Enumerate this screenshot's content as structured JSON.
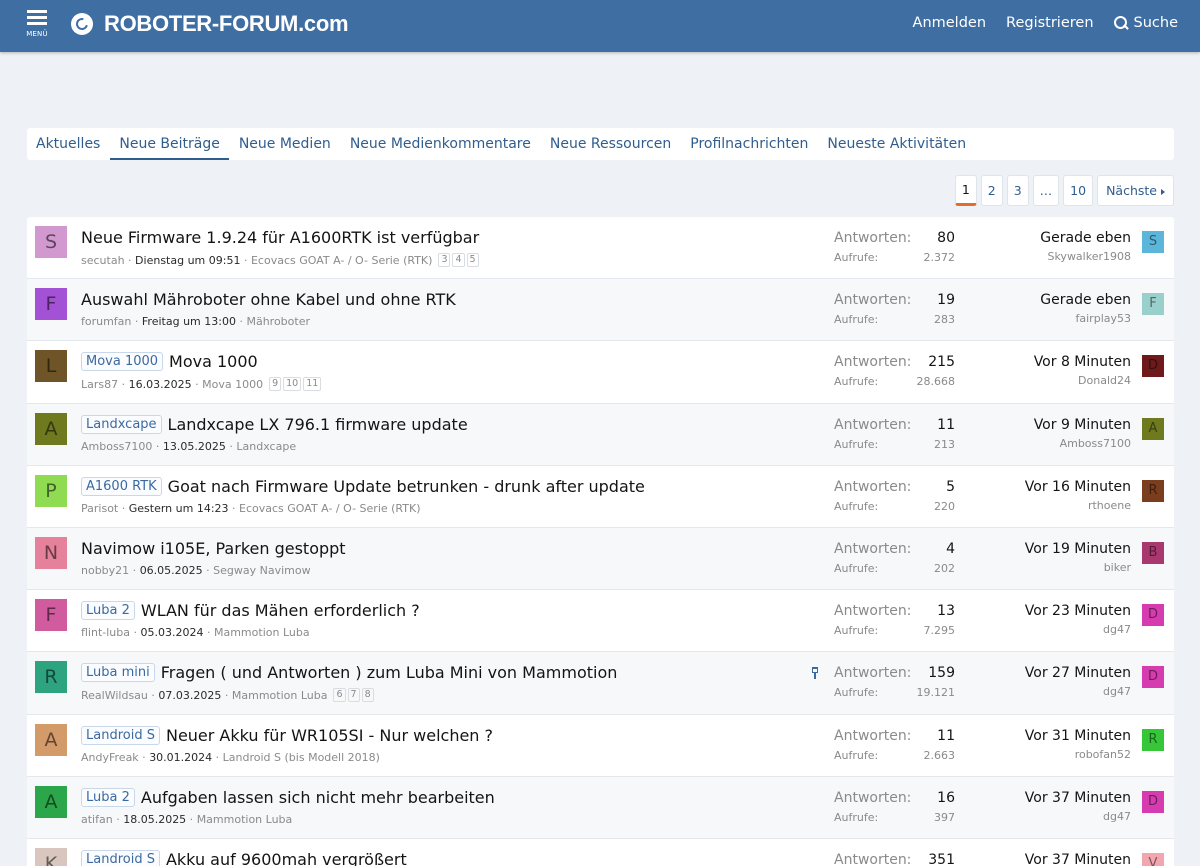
{
  "header": {
    "menu_label": "MENÜ",
    "logo_text": "ROBOTER-FORUM.com",
    "login": "Anmelden",
    "register": "Registrieren",
    "search": "Suche"
  },
  "tabs": [
    "Aktuelles",
    "Neue Beiträge",
    "Neue Medien",
    "Neue Medienkommentare",
    "Neue Ressourcen",
    "Profilnachrichten",
    "Neueste Aktivitäten"
  ],
  "active_tab": "Neue Beiträge",
  "pagination": {
    "pages": [
      "1",
      "2",
      "3",
      "…",
      "10"
    ],
    "current": "1",
    "next": "Nächste"
  },
  "labels": {
    "replies": "Antworten:",
    "views": "Aufrufe:"
  },
  "threads": [
    {
      "letter": "S",
      "color": "#d199cf",
      "prefix": "",
      "title": "Neue Firmware 1.9.24 für A1600RTK ist verfügbar",
      "author": "secutah",
      "date": "Dienstag um 09:51",
      "forum": "Ecovacs GOAT A- / O- Serie (RTK)",
      "pages": [
        "3",
        "4",
        "5"
      ],
      "replies": "80",
      "views": "2.372",
      "last_time": "Gerade eben",
      "last_user": "Skywalker1908",
      "last_letter": "S",
      "last_color": "#5cb6da",
      "pinned": false
    },
    {
      "letter": "F",
      "color": "#a352d6",
      "prefix": "",
      "title": "Auswahl Mähroboter ohne Kabel und ohne RTK",
      "author": "forumfan",
      "date": "Freitag um 13:00",
      "forum": "Mähroboter",
      "pages": [],
      "replies": "19",
      "views": "283",
      "last_time": "Gerade eben",
      "last_user": "fairplay53",
      "last_letter": "F",
      "last_color": "#9ad0cc",
      "pinned": false
    },
    {
      "letter": "L",
      "color": "#6f5427",
      "prefix": "Mova 1000",
      "title": "Mova 1000",
      "author": "Lars87",
      "date": "16.03.2025",
      "forum": "Mova 1000",
      "pages": [
        "9",
        "10",
        "11"
      ],
      "replies": "215",
      "views": "28.668",
      "last_time": "Vor 8 Minuten",
      "last_user": "Donald24",
      "last_letter": "D",
      "last_color": "#6e1a1a",
      "pinned": false
    },
    {
      "letter": "A",
      "color": "#6f7a1f",
      "prefix": "Landxcape",
      "title": "Landxcape LX 796.1 firmware update",
      "author": "Amboss7100",
      "date": "13.05.2025",
      "forum": "Landxcape",
      "pages": [],
      "replies": "11",
      "views": "213",
      "last_time": "Vor 9 Minuten",
      "last_user": "Amboss7100",
      "last_letter": "A",
      "last_color": "#6f7a1f",
      "pinned": false
    },
    {
      "letter": "P",
      "color": "#8fdc52",
      "prefix": "A1600 RTK",
      "title": "Goat nach Firmware Update betrunken - drunk after update",
      "author": "Parisot",
      "date": "Gestern um 14:23",
      "forum": "Ecovacs GOAT A- / O- Serie (RTK)",
      "pages": [],
      "replies": "5",
      "views": "220",
      "last_time": "Vor 16 Minuten",
      "last_user": "rthoene",
      "last_letter": "R",
      "last_color": "#7a3e1e",
      "pinned": false
    },
    {
      "letter": "N",
      "color": "#e6819c",
      "prefix": "",
      "title": "Navimow i105E, Parken gestoppt",
      "author": "nobby21",
      "date": "06.05.2025",
      "forum": "Segway Navimow",
      "pages": [],
      "replies": "4",
      "views": "202",
      "last_time": "Vor 19 Minuten",
      "last_user": "biker",
      "last_letter": "B",
      "last_color": "#a8386e",
      "pinned": false
    },
    {
      "letter": "F",
      "color": "#d05c9f",
      "prefix": "Luba 2",
      "title": "WLAN für das Mähen erforderlich ?",
      "author": "flint-luba",
      "date": "05.03.2024",
      "forum": "Mammotion Luba",
      "pages": [],
      "replies": "13",
      "views": "7.295",
      "last_time": "Vor 23 Minuten",
      "last_user": "dg47",
      "last_letter": "D",
      "last_color": "#d63cb0",
      "pinned": false
    },
    {
      "letter": "R",
      "color": "#2da37f",
      "prefix": "Luba mini",
      "title": "Fragen ( und Antworten ) zum Luba Mini von Mammotion",
      "author": "RealWildsau",
      "date": "07.03.2025",
      "forum": "Mammotion Luba",
      "pages": [
        "6",
        "7",
        "8"
      ],
      "replies": "159",
      "views": "19.121",
      "last_time": "Vor 27 Minuten",
      "last_user": "dg47",
      "last_letter": "D",
      "last_color": "#d63cb0",
      "pinned": true
    },
    {
      "letter": "A",
      "color": "#d39a6a",
      "prefix": "Landroid S",
      "title": "Neuer Akku für WR105SI - Nur welchen ?",
      "author": "AndyFreak",
      "date": "30.01.2024",
      "forum": "Landroid S (bis Modell 2018)",
      "pages": [],
      "replies": "11",
      "views": "2.663",
      "last_time": "Vor 31 Minuten",
      "last_user": "robofan52",
      "last_letter": "R",
      "last_color": "#36c738",
      "pinned": false
    },
    {
      "letter": "A",
      "color": "#2ba64a",
      "prefix": "Luba 2",
      "title": "Aufgaben lassen sich nicht mehr bearbeiten",
      "author": "atifan",
      "date": "18.05.2025",
      "forum": "Mammotion Luba",
      "pages": [],
      "replies": "16",
      "views": "397",
      "last_time": "Vor 37 Minuten",
      "last_user": "dg47",
      "last_letter": "D",
      "last_color": "#d63cb0",
      "pinned": false
    },
    {
      "letter": "K",
      "color": "#d9c7bf",
      "prefix": "Landroid S",
      "title": "Akku auf 9600mah vergrößert",
      "author": "",
      "date": "",
      "forum": "",
      "pages": [],
      "replies": "351",
      "views": "",
      "last_time": "Vor 37 Minuten",
      "last_user": "",
      "last_letter": "V",
      "last_color": "#f2a6b0",
      "pinned": false
    }
  ]
}
